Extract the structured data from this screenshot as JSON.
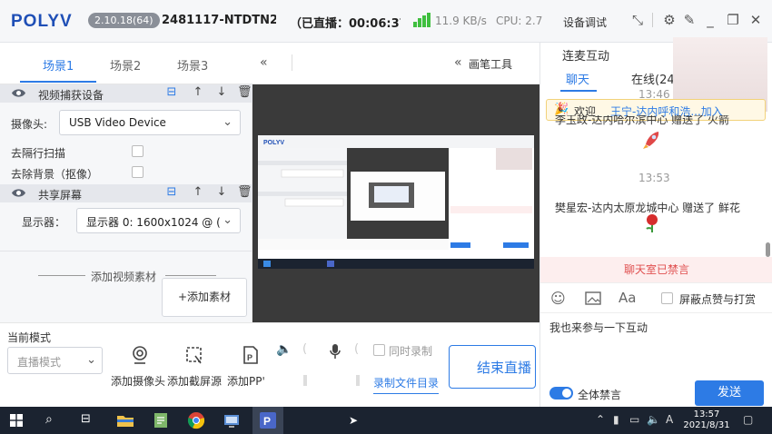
{
  "titlebar": {
    "logo": "POLYV",
    "version": "2.10.18(64)",
    "account": "2481117-NTDTN2'",
    "live_status": "（已直播：00:06:37",
    "net_speed": "11.9 KB/s",
    "cpu": "CPU: 2.7",
    "device_settings": "设备调试"
  },
  "scenes": {
    "tabs": [
      "场景1",
      "场景2",
      "场景3"
    ],
    "active_tab": 0
  },
  "sources": {
    "camera_capture": {
      "label": "视频捕获设备",
      "camera_label": "摄像头:",
      "camera_value": "USB Video Device",
      "deinterlace_label": "去隔行扫描",
      "remove_bg_label": "去除背景（抠像）"
    },
    "screen_share": {
      "label": "共享屏幕",
      "display_label": "显示器：",
      "display_value": "显示器 0: 1600x1024 @ ("
    },
    "add_material_divider": "添加视频素材",
    "add_material_button": "+添加素材"
  },
  "preview": {
    "pen_tool": "画笔工具"
  },
  "controls": {
    "mode_label": "当前模式",
    "mode_placeholder": "直播模式",
    "tools": [
      "添加摄像头",
      "添加截屏源",
      "添加PP'"
    ],
    "sync_record": "同时录制",
    "record_dir": "录制文件目录",
    "end_live": "结束直播"
  },
  "chat": {
    "title": "连麦互动",
    "tabs": [
      "聊天",
      "在线(24"
    ],
    "welcome_prefix": "欢迎",
    "welcome_user": "王宁-达内呼和浩...加入",
    "messages": [
      {
        "time": "13:46",
        "text": "李玉政-达内哈尔滨中心 赠送了 火箭"
      },
      {
        "time": "13:53",
        "text": "樊星宏-达内太原龙城中心 赠送了 鲜花"
      }
    ],
    "banned_notice": "聊天室已禁言",
    "block_gifts": "屏蔽点赞与打赏",
    "input_text": "我也来参与一下互动",
    "mute_all": "全体禁言",
    "send": "发送"
  },
  "taskbar": {
    "time": "13:57",
    "date": "2021/8/31",
    "ime": "A"
  },
  "colors": {
    "accent": "#2d7be5",
    "logo": "#1f4fb6",
    "banned": "#e05050",
    "taskbar": "#1b2330"
  }
}
